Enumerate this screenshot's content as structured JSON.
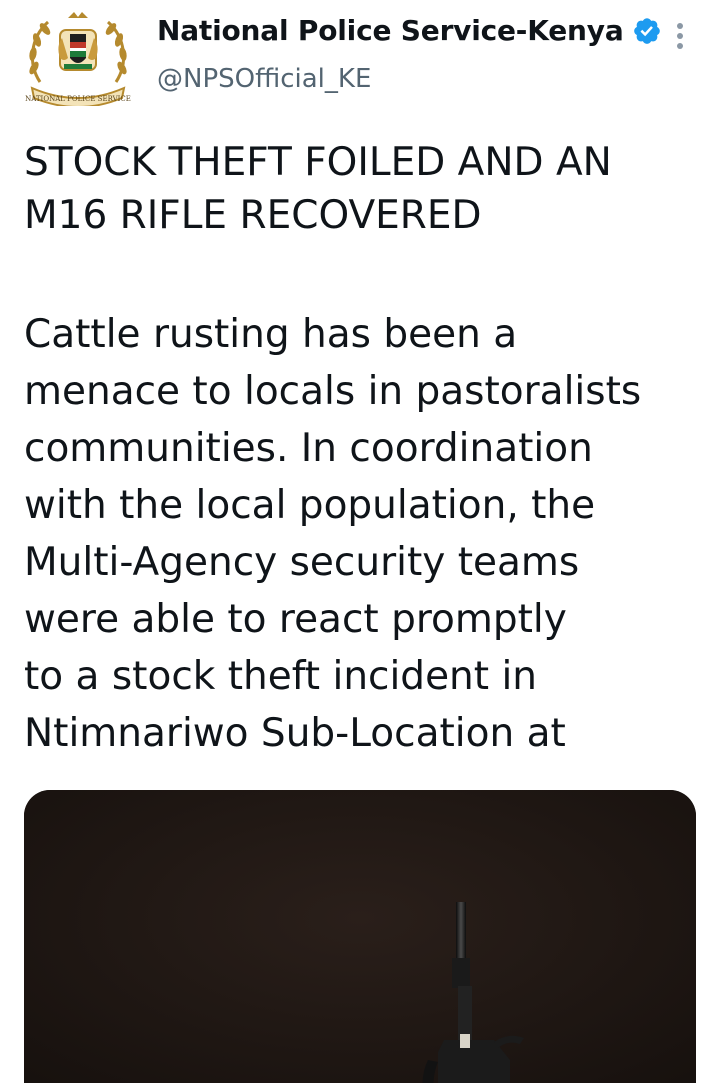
{
  "author": {
    "display_name": "National Police Service-Kenya",
    "handle": "@NPSOfficial_KE",
    "verified": true,
    "avatar_icon": "nps-emblem-icon",
    "avatar_ring_text": "NATIONAL POLICE SERVICE",
    "avatar_colors": {
      "gold": "#b58a2e",
      "shield_red": "#c0392b",
      "shield_green": "#1e7b3a"
    }
  },
  "menu": {
    "icon": "more-vertical-icon"
  },
  "tweet": {
    "headline": "STOCK THEFT FOILED AND AN\nM16 RIFLE RECOVERED",
    "body": "Cattle rusting has been a\nmenace to locals in pastoralists\ncommunities. In coordination\nwith the local population, the\nMulti-Agency security teams\nwere able to react promptly\nto a stock theft incident in\nNtimnariwo Sub-Location at"
  },
  "media": {
    "type": "photo",
    "subject": "rifle-photo",
    "background_color": "#1f1612"
  },
  "colors": {
    "text_primary": "#0f1419",
    "text_secondary": "#536471",
    "verified_blue": "#1d9bf0",
    "menu_dots": "#8b98a5"
  }
}
